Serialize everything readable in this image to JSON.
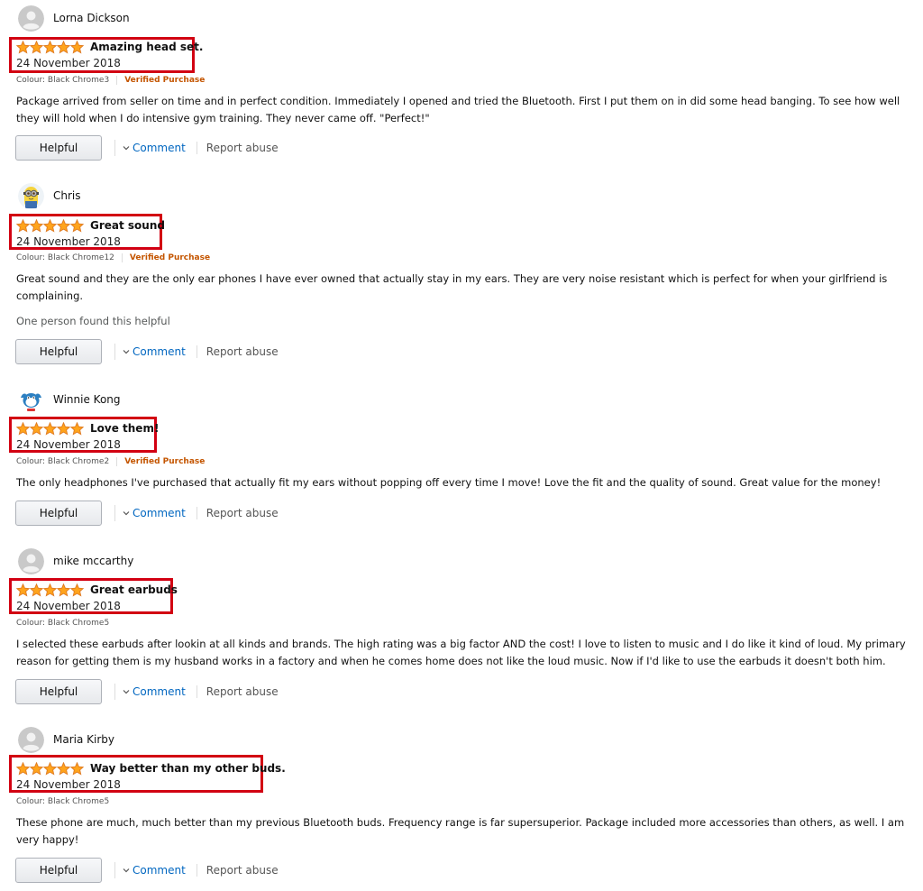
{
  "reviews": [
    {
      "name": "Lorna Dickson",
      "avatar": "default-avatar-icon",
      "title": "Amazing head set.",
      "date": "24 November 2018",
      "colour": "Colour: Black Chrome3",
      "verified": "Verified Purchase",
      "body": "Package arrived from seller on time and in perfect condition. Immediately I opened and tried the Bluetooth. First I put them on in did some head banging. To see how well they will hold when I do intensive gym training. They never came off. \"Perfect!\"",
      "helpful_count": "",
      "helpful_label": "Helpful",
      "comment_label": "Comment",
      "report_label": "Report abuse",
      "rating": 5
    },
    {
      "name": "Chris",
      "avatar": "minion-avatar-icon",
      "title": "Great sound",
      "date": "24 November 2018",
      "colour": "Colour: Black Chrome12",
      "verified": "Verified Purchase",
      "body": "Great sound and they are the only ear phones I have ever owned that actually stay in my ears. They are very noise resistant which is perfect for when your girlfriend is complaining.",
      "helpful_count": "One person found this helpful",
      "helpful_label": "Helpful",
      "comment_label": "Comment",
      "report_label": "Report abuse",
      "rating": 5
    },
    {
      "name": "Winnie Kong",
      "avatar": "cartoon-avatar-icon",
      "title": "Love them!",
      "date": "24 November 2018",
      "colour": "Colour: Black Chrome2",
      "verified": "Verified Purchase",
      "body": "The only headphones I've purchased that actually fit my ears without popping off every time I move! Love the fit and the quality of sound. Great value for the money!",
      "helpful_count": "",
      "helpful_label": "Helpful",
      "comment_label": "Comment",
      "report_label": "Report abuse",
      "rating": 5
    },
    {
      "name": "mike mccarthy",
      "avatar": "default-avatar-icon",
      "title": "Great earbuds",
      "date": "24 November 2018",
      "colour": "Colour: Black Chrome5",
      "verified": "",
      "body": "I selected these earbuds after lookin at all kinds and brands. The high rating was a big factor AND the cost! I love to listen to music and I do like it kind of loud. My primary reason for getting them is my husband works in a factory and when he comes home does not like the loud music. Now if I'd like to use the earbuds it doesn't both him.",
      "helpful_count": "",
      "helpful_label": "Helpful",
      "comment_label": "Comment",
      "report_label": "Report abuse",
      "rating": 5
    },
    {
      "name": "Maria Kirby",
      "avatar": "default-avatar-icon",
      "title": "Way better than my other buds.",
      "date": "24 November 2018",
      "colour": "Colour: Black Chrome5",
      "verified": "",
      "body": "These phone are much, much better than my previous Bluetooth buds. Frequency range is far supersuperior. Package included more accessories than others, as well. I am very happy!",
      "helpful_count": "",
      "helpful_label": "Helpful",
      "comment_label": "Comment",
      "report_label": "Report abuse",
      "rating": 5
    }
  ],
  "colors": {
    "highlight_border": "#d20012",
    "star_fill": "#ffa41c",
    "star_stroke": "#de7921",
    "link": "#0066c0",
    "verified": "#c45500"
  }
}
